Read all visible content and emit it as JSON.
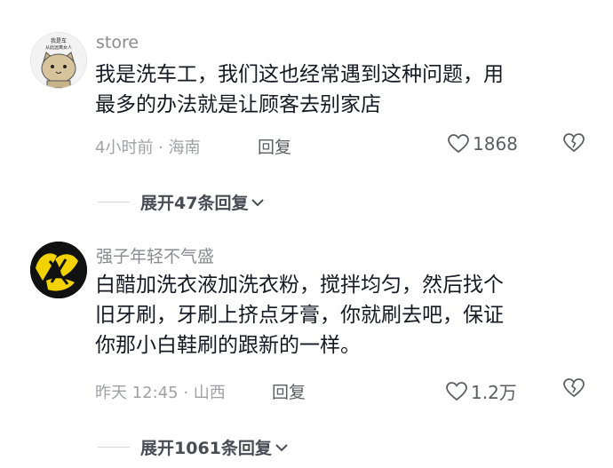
{
  "comments": [
    {
      "username": "store",
      "avatar_text": [
        "我是车",
        "从此远离女人"
      ],
      "lines": [
        "我是洗车工，我们这也经常遇到这种问题，用",
        "最多的办法就是让顾客去别家店"
      ],
      "meta": "4小时前 · 海南",
      "reply_label": "回复",
      "likes": "1868",
      "expand_label": "展开47条回复"
    },
    {
      "username": "强子年轻不气盛",
      "lines": [
        "白醋加洗衣液加洗衣粉，搅拌均匀，然后找个",
        "旧牙刷，牙刷上挤点牙膏，你就刷去吧，保证",
        "你那小白鞋刷的跟新的一样。"
      ],
      "meta": "昨天 12:45 · 山西",
      "reply_label": "回复",
      "likes": "1.2万",
      "expand_label": "展开1061条回复"
    }
  ]
}
